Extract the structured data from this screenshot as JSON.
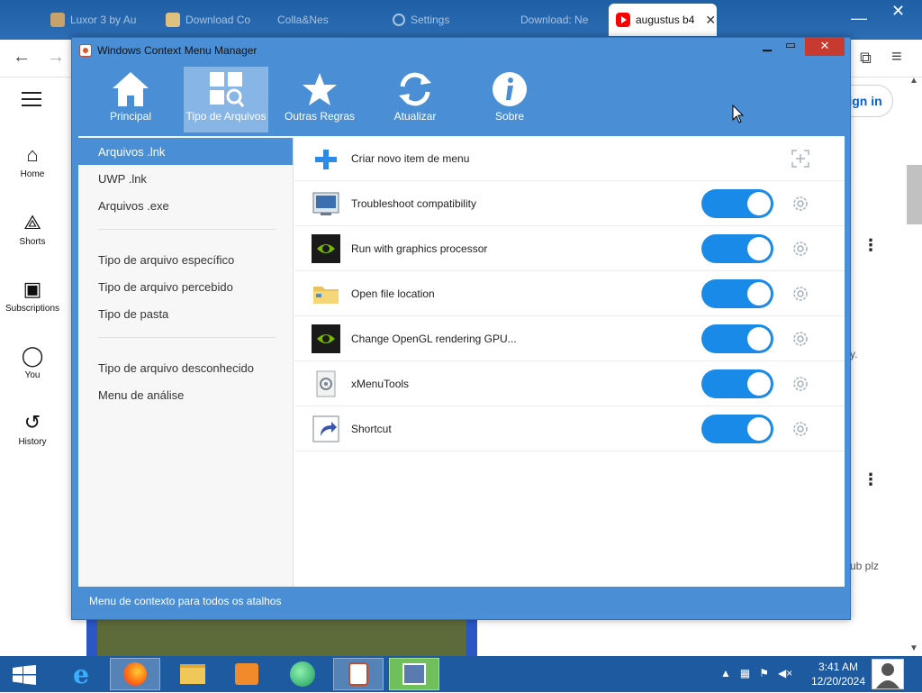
{
  "browser": {
    "tabs": [
      {
        "label": "Luxor 3 by Au"
      },
      {
        "label": "Download Co"
      },
      {
        "label": "Colla&Nes"
      },
      {
        "label": "Settings"
      },
      {
        "label": "Download: Ne"
      },
      {
        "label": "augustus b4"
      }
    ],
    "signin_label": "Sign in",
    "side_text_1": "y.",
    "side_text_2": "ub plz",
    "nav": [
      {
        "label": "Home"
      },
      {
        "label": "Shorts"
      },
      {
        "label": "Subscriptions"
      },
      {
        "label": "You"
      },
      {
        "label": "History"
      }
    ]
  },
  "window": {
    "title": "Windows Context Menu Manager"
  },
  "ribbon": {
    "buttons": [
      {
        "label": "Principal",
        "icon": "home-icon"
      },
      {
        "label": "Tipo de Arquivos",
        "icon": "file-types-icon"
      },
      {
        "label": "Outras Regras",
        "icon": "star-icon"
      },
      {
        "label": "Atualizar",
        "icon": "refresh-icon"
      },
      {
        "label": "Sobre",
        "icon": "info-icon"
      }
    ]
  },
  "sidebar": {
    "group1": [
      "Arquivos .lnk",
      "UWP .lnk",
      "Arquivos .exe"
    ],
    "group2": [
      "Tipo de arquivo específico",
      "Tipo de arquivo percebido",
      "Tipo de pasta"
    ],
    "group3": [
      "Tipo de arquivo desconhecido",
      "Menu de análise"
    ]
  },
  "list": {
    "new_item_label": "Criar novo item de menu",
    "items": [
      {
        "label": "Troubleshoot compatibility",
        "enabled": true,
        "icon": "compatibility-icon"
      },
      {
        "label": "Run with graphics processor",
        "enabled": true,
        "icon": "nvidia-icon"
      },
      {
        "label": "Open file location",
        "enabled": true,
        "icon": "folder-icon"
      },
      {
        "label": "Change OpenGL rendering GPU...",
        "enabled": true,
        "icon": "nvidia-icon"
      },
      {
        "label": "xMenuTools",
        "enabled": true,
        "icon": "xmenutools-icon"
      },
      {
        "label": "Shortcut",
        "enabled": true,
        "icon": "shortcut-icon"
      }
    ]
  },
  "statusbar": {
    "text": "Menu de contexto para todos os atalhos"
  },
  "taskbar": {
    "time": "3:41 AM",
    "date": "12/20/2024"
  },
  "colors": {
    "accent": "#4a8fd6",
    "toggle_on": "#1a8ae8",
    "close_button": "#c73a30"
  }
}
